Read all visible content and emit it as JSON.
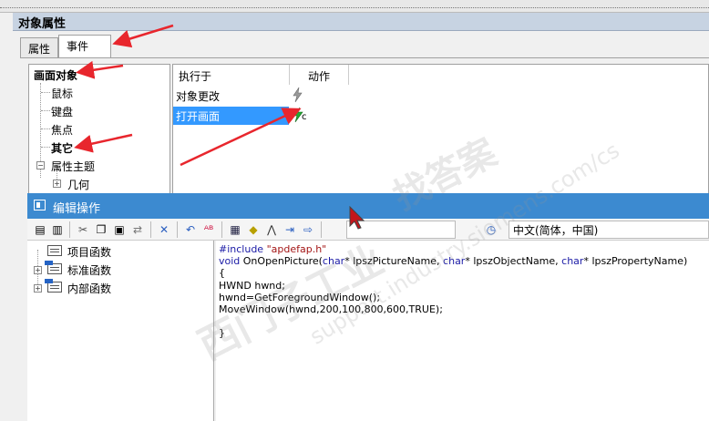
{
  "window1": {
    "title": "对象属性",
    "tabs": [
      {
        "label": "属性",
        "active": false
      },
      {
        "label": "事件",
        "active": true
      }
    ],
    "tree": {
      "root": "画面对象",
      "items": [
        "鼠标",
        "键盘",
        "焦点",
        "其它",
        "属性主题",
        "几何"
      ]
    },
    "grid": {
      "columns": [
        "执行于",
        "动作"
      ],
      "rows": [
        {
          "label": "对象更改",
          "selected": false,
          "action_icon": "lightning-icon"
        },
        {
          "label": "打开画面",
          "selected": true,
          "action_icon": "c-action-icon",
          "action_suffix": "c"
        }
      ]
    }
  },
  "window2": {
    "title": "编辑操作",
    "language": "中文(简体，中国)",
    "function_tree": [
      "项目函数",
      "标准函数",
      "内部函数"
    ],
    "code_lines": [
      {
        "parts": [
          [
            "#include ",
            "kw"
          ],
          [
            "\"apdefap.h\"",
            "str"
          ]
        ]
      },
      {
        "parts": [
          [
            "void",
            "kw"
          ],
          [
            " OnOpenPicture(",
            ""
          ],
          [
            "char",
            "kw"
          ],
          [
            "* lpszPictureName, ",
            ""
          ],
          [
            "char",
            "kw"
          ],
          [
            "* lpszObjectName, ",
            ""
          ],
          [
            "char",
            "kw"
          ],
          [
            "* lpszPropertyName)",
            ""
          ]
        ]
      },
      {
        "parts": [
          [
            "{",
            ""
          ]
        ]
      },
      {
        "parts": [
          [
            "HWND hwnd;",
            ""
          ]
        ]
      },
      {
        "parts": [
          [
            "hwnd=GetForegroundWindow();",
            ""
          ]
        ]
      },
      {
        "parts": [
          [
            "MoveWindow(hwnd,200,100,800,600,TRUE);",
            ""
          ]
        ]
      },
      {
        "parts": [
          [
            "",
            ""
          ]
        ]
      },
      {
        "parts": [
          [
            "}",
            ""
          ]
        ]
      }
    ]
  },
  "watermark": {
    "line1": "西门子工业",
    "line2": "找答案",
    "url": "support.industry.siemens.com/cs"
  },
  "colors": {
    "accent_blue": "#3c8ad0",
    "selection": "#3399ff",
    "arrow_red": "#e8262d"
  }
}
